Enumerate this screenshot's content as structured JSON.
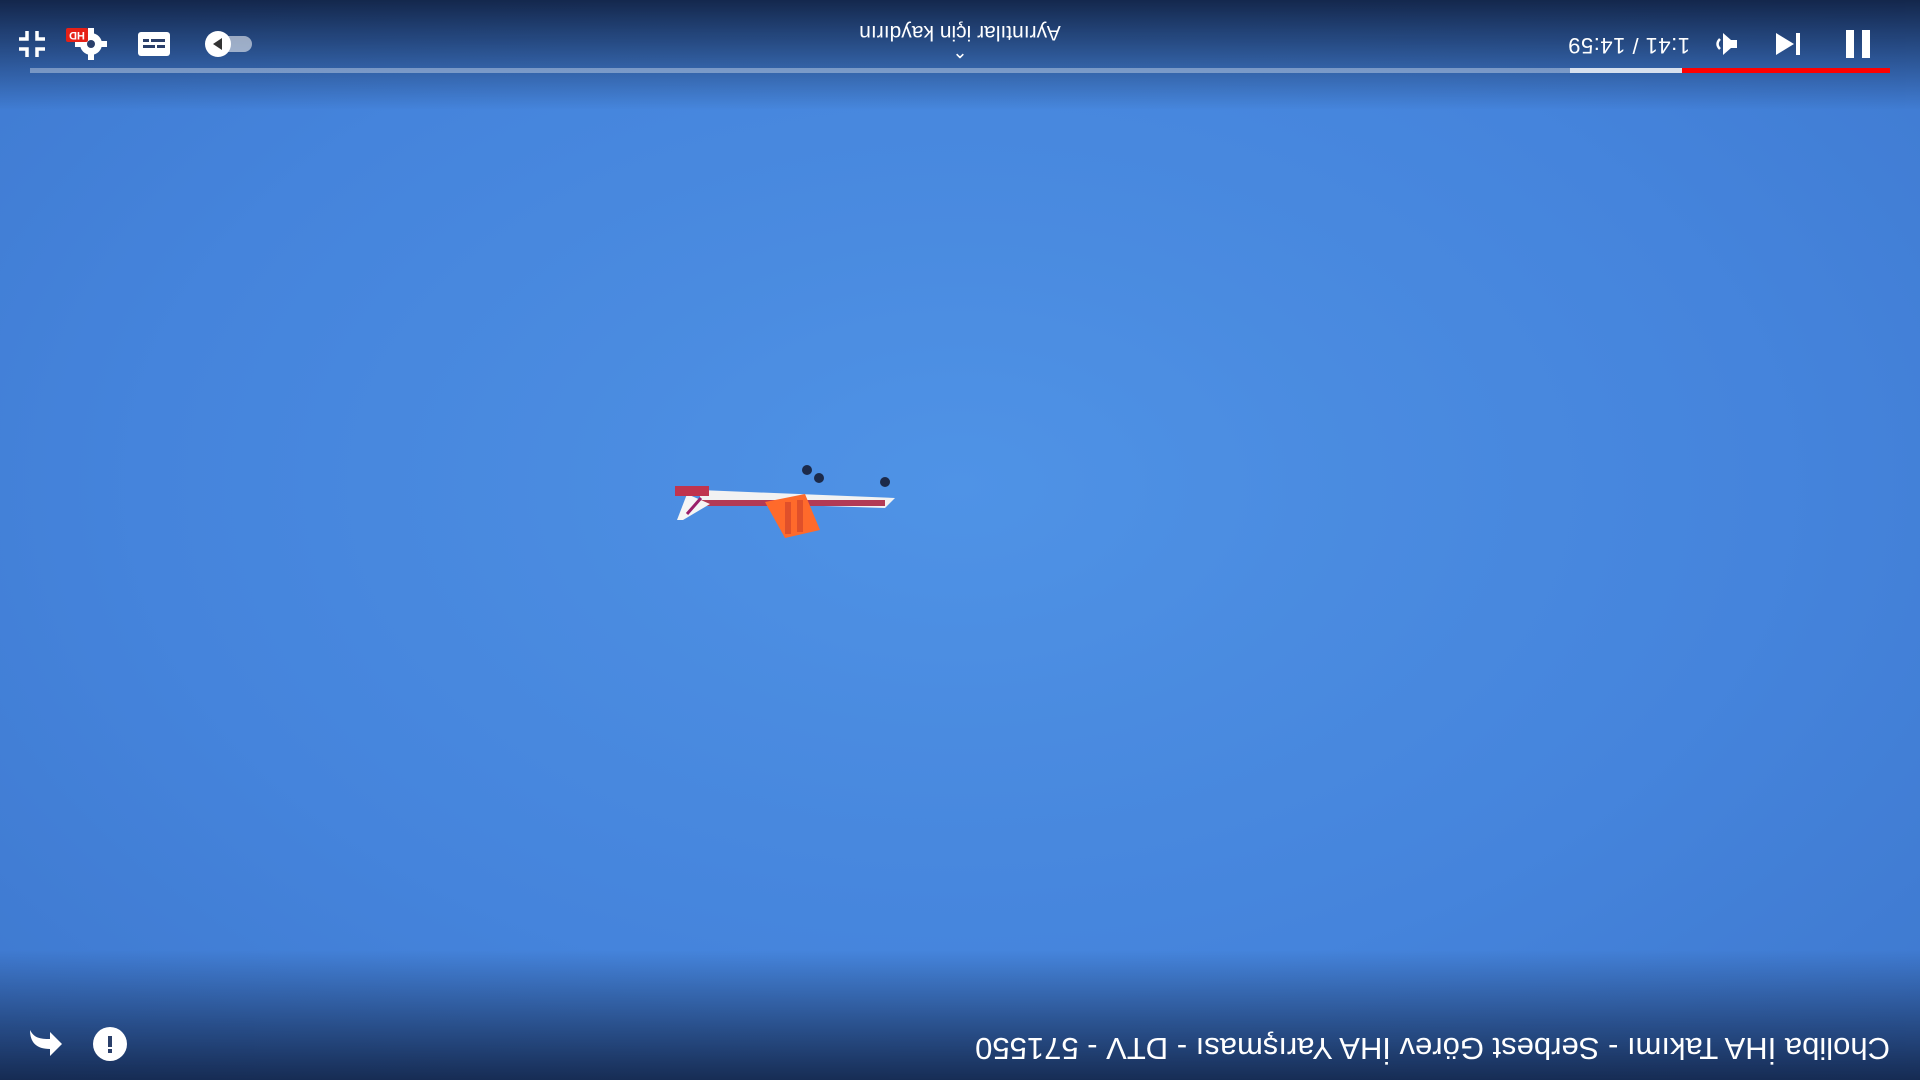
{
  "video": {
    "title": "Cholibа İHA Takımı - Serbest Görev İHA Yarışması - DTV - 571550",
    "swipe_hint": "Ayrıntılar için kaydırın",
    "time_display": "1:41 / 14:59",
    "current_time": "1:41",
    "duration": "14:59",
    "played_fraction": 0.112,
    "buffered_fraction": 0.172,
    "quality_badge": "HD"
  },
  "icons": {
    "pause": "pause-icon",
    "previous": "skip-previous-icon",
    "volume": "volume-icon",
    "autoplay": "autoplay-toggle-icon",
    "captions": "captions-icon",
    "settings": "settings-gear-icon",
    "exit_fullscreen": "exit-fullscreen-icon",
    "back": "back-arrow-icon",
    "info": "info-icon"
  },
  "colors": {
    "progress_played": "#ff0000",
    "sky": "#4a8be0",
    "hd_badge": "#e62117"
  }
}
